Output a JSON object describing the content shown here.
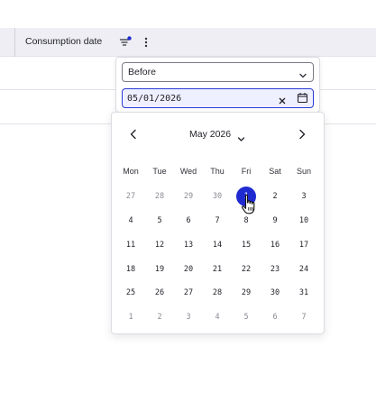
{
  "column_header": {
    "label": "Consumption date",
    "filter_active": true
  },
  "filter": {
    "operator": "Before",
    "date_value": "05/01/2026"
  },
  "calendar": {
    "month_label": "May 2026",
    "weekdays": [
      "Mon",
      "Tue",
      "Wed",
      "Thu",
      "Fri",
      "Sat",
      "Sun"
    ],
    "weeks": [
      [
        "27",
        "28",
        "29",
        "30",
        "1",
        "2",
        "3"
      ],
      [
        "4",
        "5",
        "6",
        "7",
        "8",
        "9",
        "10"
      ],
      [
        "11",
        "12",
        "13",
        "14",
        "15",
        "16",
        "17"
      ],
      [
        "18",
        "19",
        "20",
        "21",
        "22",
        "23",
        "24"
      ],
      [
        "25",
        "26",
        "27",
        "28",
        "29",
        "30",
        "31"
      ],
      [
        "1",
        "2",
        "3",
        "4",
        "5",
        "6",
        "7"
      ]
    ],
    "outside_month": [
      [
        true,
        true,
        true,
        true,
        false,
        false,
        false
      ],
      [
        false,
        false,
        false,
        false,
        false,
        false,
        false
      ],
      [
        false,
        false,
        false,
        false,
        false,
        false,
        false
      ],
      [
        false,
        false,
        false,
        false,
        false,
        false,
        false
      ],
      [
        false,
        false,
        false,
        false,
        false,
        false,
        false
      ],
      [
        true,
        true,
        true,
        true,
        true,
        true,
        true
      ]
    ],
    "selected_day": "1"
  },
  "colors": {
    "accent": "#1f2bd1",
    "header_bg": "#eeeef4",
    "input_focus_bg": "#eef0ff"
  }
}
